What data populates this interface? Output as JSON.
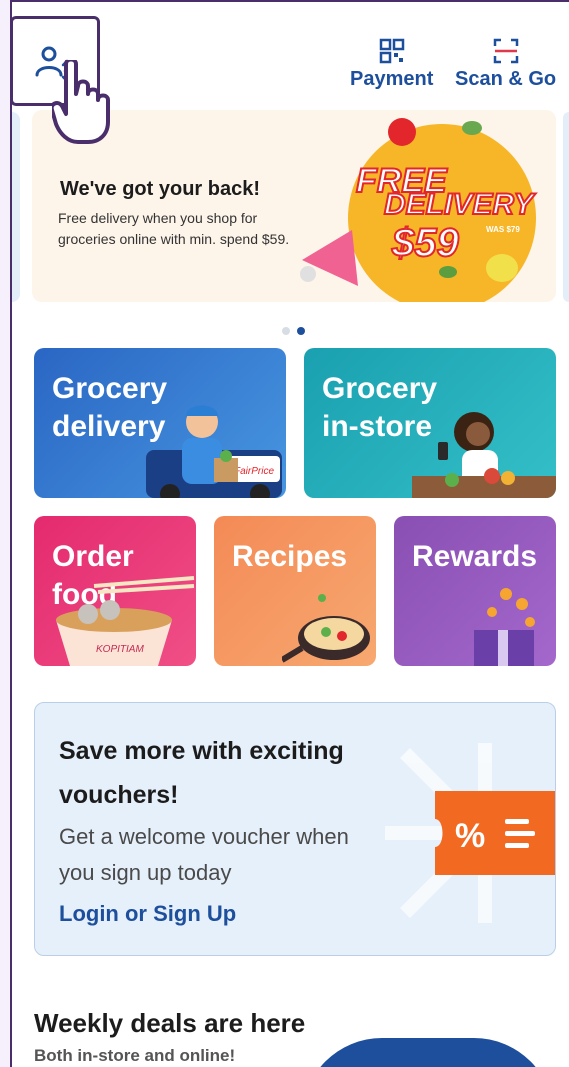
{
  "header": {
    "payment_label": "Payment",
    "scan_label": "Scan & Go"
  },
  "banner": {
    "title": "We've got your back!",
    "subtitle": "Free delivery when you shop for groceries online with min. spend $59.",
    "promo_line1": "FREE",
    "promo_line2": "DELIVERY",
    "promo_price": "$59",
    "promo_was": "WAS $79"
  },
  "tiles": {
    "grocery_delivery": "Grocery\ndelivery",
    "grocery_instore": "Grocery\nin-store",
    "order_food": "Order\nfood",
    "recipes": "Recipes",
    "rewards": "Rewards",
    "fairprice_text": "FairPrice",
    "kopitiam_text": "KOPITIAM"
  },
  "voucher": {
    "title": "Save more with exciting vouchers!",
    "subtitle": "Get a welcome voucher when you sign up today",
    "link": "Login or Sign Up",
    "badge": "%"
  },
  "weekly": {
    "title": "Weekly deals are here",
    "subtitle": "Both in-store and online!"
  },
  "colors": {
    "brand_blue": "#1d4f9c",
    "highlight_purple": "#4a2e6b"
  }
}
